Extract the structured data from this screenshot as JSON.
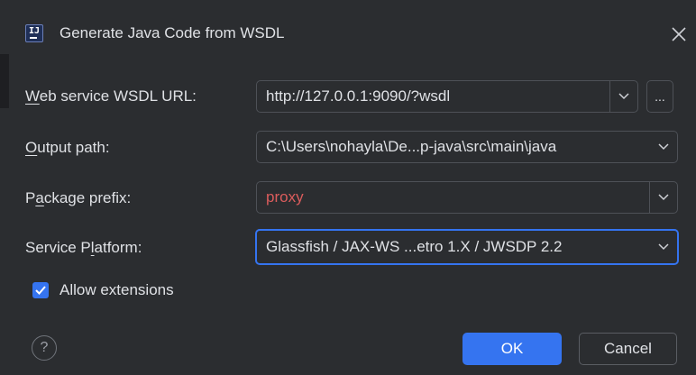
{
  "dialog": {
    "title": "Generate Java Code from WSDL",
    "logo_text": "IJ",
    "close_icon": "close-icon"
  },
  "form": {
    "wsdl_url": {
      "label_mnemonic": "W",
      "label_rest": "eb service WSDL URL:",
      "value": "http://127.0.0.1:9090/?wsdl",
      "browse_label": "..."
    },
    "output_path": {
      "label_mnemonic": "O",
      "label_rest": "utput path:",
      "value": "C:\\Users\\nohayla\\De...p-java\\src\\main\\java"
    },
    "package_prefix": {
      "label_before": "P",
      "label_mnemonic": "a",
      "label_rest": "ckage prefix:",
      "value": "proxy",
      "value_color": "#db5c5c"
    },
    "service_platform": {
      "label_before": "Service P",
      "label_mnemonic": "l",
      "label_rest": "atform:",
      "value": "Glassfish / JAX-WS ...etro 1.X / JWSDP 2.2"
    },
    "allow_extensions": {
      "label": "Allow extensions",
      "checked": true
    }
  },
  "footer": {
    "help_label": "?",
    "ok_label": "OK",
    "cancel_label": "Cancel"
  },
  "colors": {
    "background": "#2b2d30",
    "accent": "#3574f0",
    "text": "#dfe1e5",
    "error_text": "#db5c5c"
  }
}
